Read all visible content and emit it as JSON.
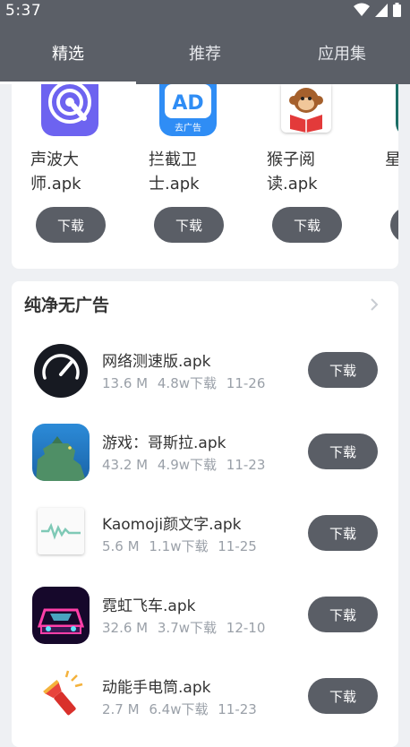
{
  "status": {
    "time": "5:37"
  },
  "tabs": [
    {
      "label": "精选",
      "active": true
    },
    {
      "label": "推荐",
      "active": false
    },
    {
      "label": "应用集",
      "active": false
    }
  ],
  "featured": {
    "items": [
      {
        "name_line1": "声波大",
        "name_line2": "师.apk",
        "button": "下载",
        "icon": "sound-wave-icon"
      },
      {
        "name_line1": "拦截卫",
        "name_line2": "士.apk",
        "button": "下载",
        "icon": "ad-block-icon",
        "icon_text_main": "AD",
        "icon_text_sub": "去广告"
      },
      {
        "name_line1": "猴子阅",
        "name_line2": "读.apk",
        "button": "下载",
        "icon": "monkey-reader-icon"
      },
      {
        "name_line1": "星",
        "name_line2": "",
        "button": "",
        "icon": "partial-app-icon"
      }
    ]
  },
  "section": {
    "title": "纯净无广告",
    "apps": [
      {
        "name": "网络测速版.apk",
        "size": "13.6 M",
        "downloads": "4.8w下载",
        "date": "11-26",
        "button": "下载",
        "icon": "speedometer-icon"
      },
      {
        "name": "游戏：哥斯拉.apk",
        "size": "43.2 M",
        "downloads": "4.9w下载",
        "date": "11-23",
        "button": "下载",
        "icon": "godzilla-game-icon"
      },
      {
        "name": "Kaomoji颜文字.apk",
        "size": "5.6 M",
        "downloads": "1.1w下载",
        "date": "11-25",
        "button": "下载",
        "icon": "kaomoji-icon"
      },
      {
        "name": "霓虹飞车.apk",
        "size": "32.6 M",
        "downloads": "3.7w下载",
        "date": "12-10",
        "button": "下载",
        "icon": "neon-car-icon"
      },
      {
        "name": "动能手电筒.apk",
        "size": "2.7 M",
        "downloads": "6.4w下载",
        "date": "11-23",
        "button": "下载",
        "icon": "flashlight-icon"
      }
    ]
  },
  "colors": {
    "header": "#5b5f67",
    "button": "#5a5e66",
    "background": "#eef0f3"
  }
}
